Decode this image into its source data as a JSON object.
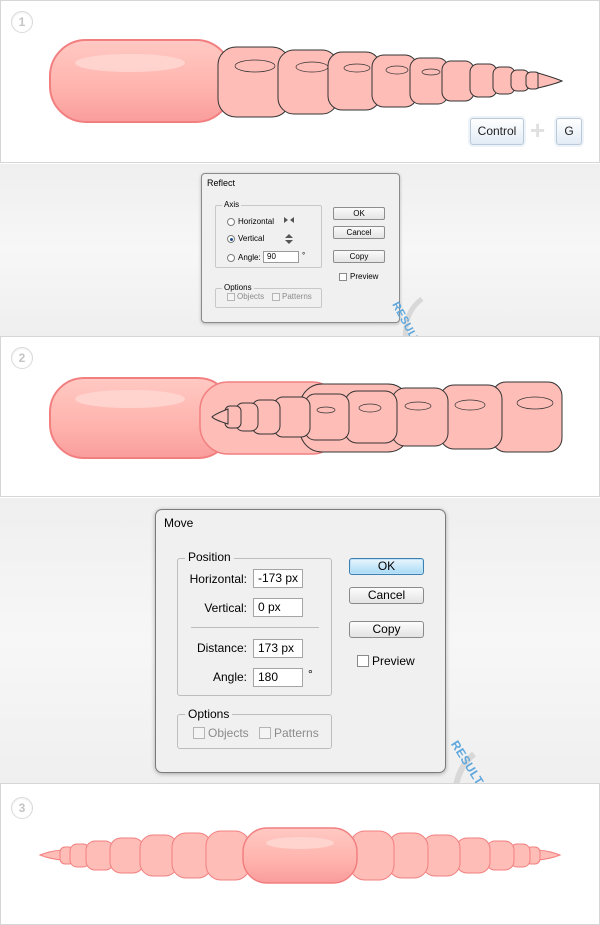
{
  "steps": [
    {
      "number": "1"
    },
    {
      "number": "2"
    },
    {
      "number": "3"
    }
  ],
  "shortcut": {
    "key1": "Control",
    "key2": "G"
  },
  "reflect_dialog": {
    "title": "Reflect",
    "axis_legend": "Axis",
    "horizontal_label": "Horizontal",
    "vertical_label": "Vertical",
    "angle_label": "Angle:",
    "angle_value": "90",
    "degree": "°",
    "options_legend": "Options",
    "objects_label": "Objects",
    "patterns_label": "Patterns",
    "ok": "OK",
    "cancel": "Cancel",
    "copy": "Copy",
    "preview": "Preview"
  },
  "move_dialog": {
    "title": "Move",
    "position_legend": "Position",
    "horizontal_label": "Horizontal:",
    "horizontal_value": "-173 px",
    "vertical_label": "Vertical:",
    "vertical_value": "0 px",
    "distance_label": "Distance:",
    "distance_value": "173 px",
    "angle_label": "Angle:",
    "angle_value": "180",
    "degree": "°",
    "options_legend": "Options",
    "objects_label": "Objects",
    "patterns_label": "Patterns",
    "ok": "OK",
    "cancel": "Cancel",
    "copy": "Copy",
    "preview": "Preview"
  },
  "result_label": "RESULT",
  "colors": {
    "worm_fill": "#ffb6b0",
    "worm_stroke": "#f27f80",
    "accent_blue": "#5ea7dd"
  }
}
